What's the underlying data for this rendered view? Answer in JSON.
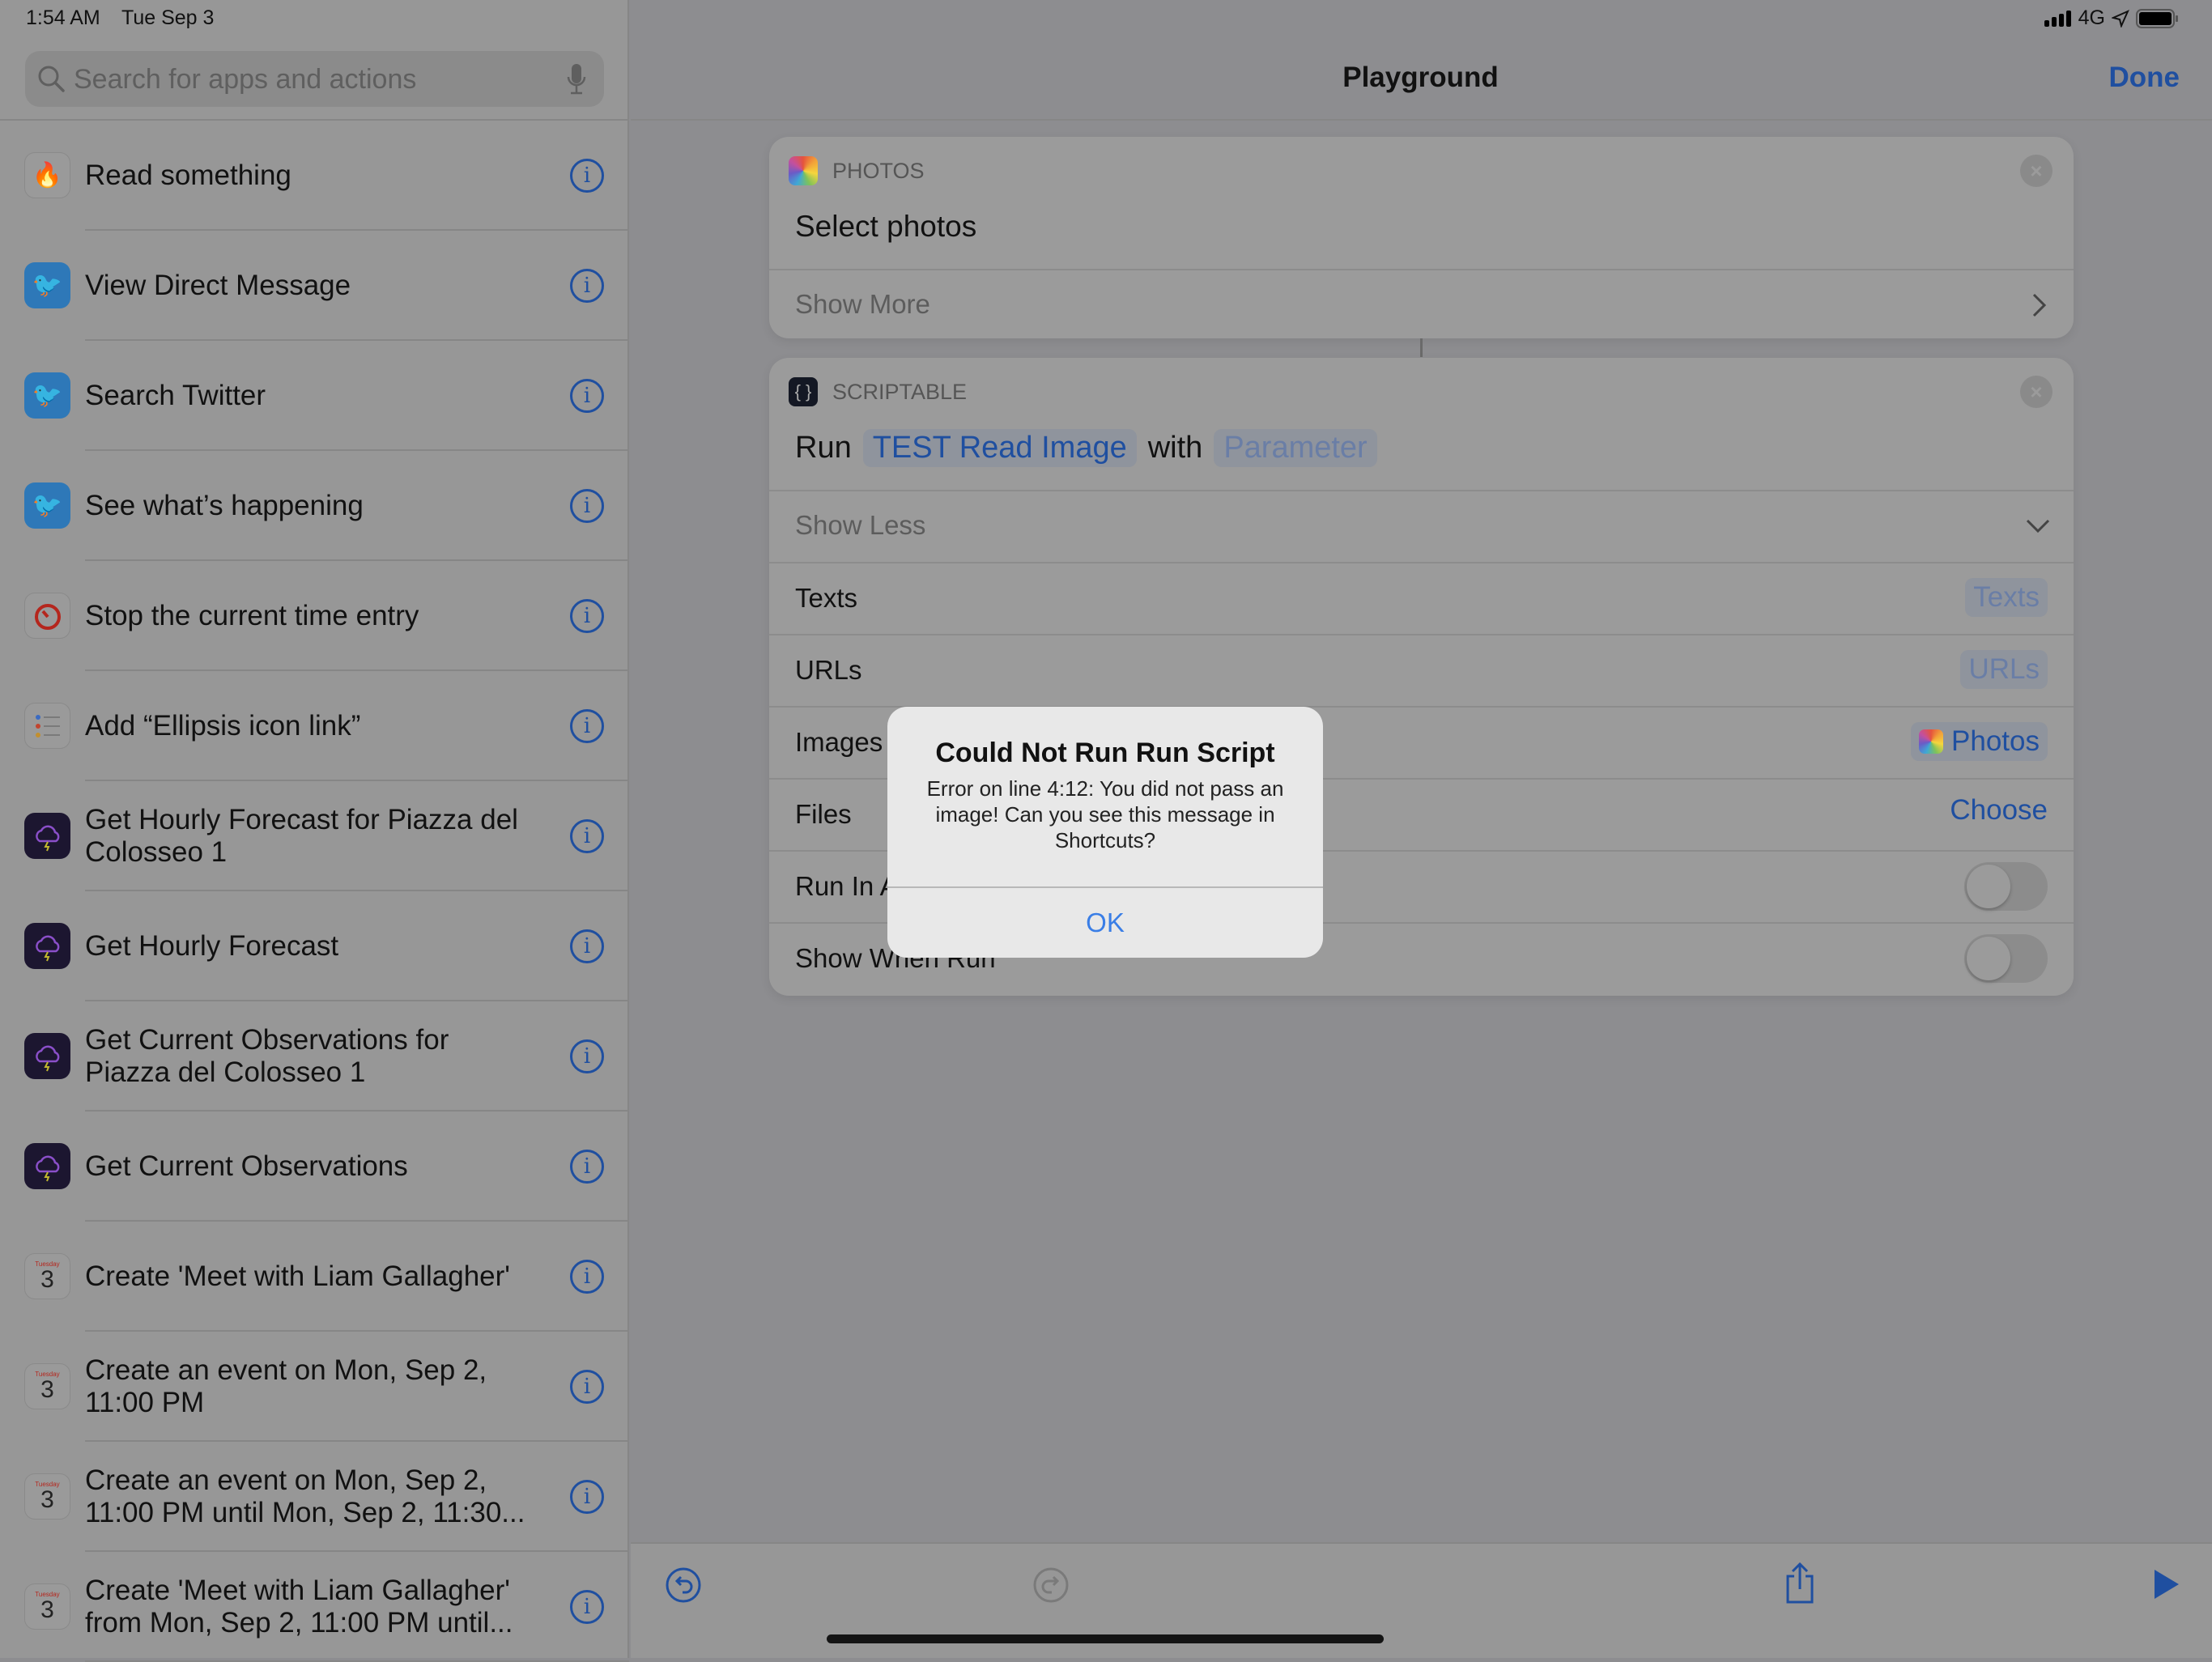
{
  "status_bar": {
    "time": "1:54 AM",
    "date": "Tue Sep 3",
    "network": "4G"
  },
  "search": {
    "placeholder": "Search for apps and actions"
  },
  "sidebar": {
    "items": [
      {
        "label": "Read something",
        "icon": "flame-icon"
      },
      {
        "label": "View Direct Message",
        "icon": "twitter-icon"
      },
      {
        "label": "Search Twitter",
        "icon": "twitter-icon"
      },
      {
        "label": "See what’s happening",
        "icon": "twitter-icon"
      },
      {
        "label": "Stop the current time entry",
        "icon": "timer-icon"
      },
      {
        "label": "Add “Ellipsis icon link”",
        "icon": "reminders-icon"
      },
      {
        "label": "Get Hourly Forecast for Piazza del Colosseo 1",
        "icon": "weather-icon"
      },
      {
        "label": "Get Hourly Forecast",
        "icon": "weather-icon"
      },
      {
        "label": "Get Current Observations for Piazza del Colosseo 1",
        "icon": "weather-icon"
      },
      {
        "label": "Get Current Observations",
        "icon": "weather-icon"
      },
      {
        "label": "Create 'Meet with Liam Gallagher'",
        "icon": "calendar-icon"
      },
      {
        "label": "Create an event on Mon, Sep 2, 11:00 PM",
        "icon": "calendar-icon"
      },
      {
        "label": "Create an event on Mon, Sep 2, 11:00 PM until Mon, Sep 2, 11:30...",
        "icon": "calendar-icon"
      },
      {
        "label": "Create 'Meet with Liam Gallagher' from Mon, Sep 2, 11:00 PM until...",
        "icon": "calendar-icon"
      }
    ],
    "calendar_day": "3",
    "calendar_weekday": "Tuesday"
  },
  "header": {
    "title": "Playground",
    "done": "Done"
  },
  "photos_card": {
    "app": "PHOTOS",
    "title": "Select photos",
    "show_more": "Show More"
  },
  "scriptable_card": {
    "app": "SCRIPTABLE",
    "run": "Run",
    "script": "TEST Read Image",
    "with": "with",
    "parameter": "Parameter",
    "show_less": "Show Less",
    "rows": [
      {
        "label": "Texts",
        "value": "Texts"
      },
      {
        "label": "URLs",
        "value": "URLs"
      },
      {
        "label": "Images",
        "value": "Photos"
      },
      {
        "label": "Files",
        "value": "Choose"
      },
      {
        "label": "Run In App",
        "toggle": false
      },
      {
        "label": "Show When Run",
        "toggle": false
      }
    ]
  },
  "dialog": {
    "title": "Could Not Run Run Script",
    "message": "Error on line 4:12: You did not pass an image! Can you see this message in Shortcuts?",
    "ok": "OK"
  },
  "colors": {
    "accent": "#1f4fa0",
    "dialog_button": "#3a7ee6"
  }
}
